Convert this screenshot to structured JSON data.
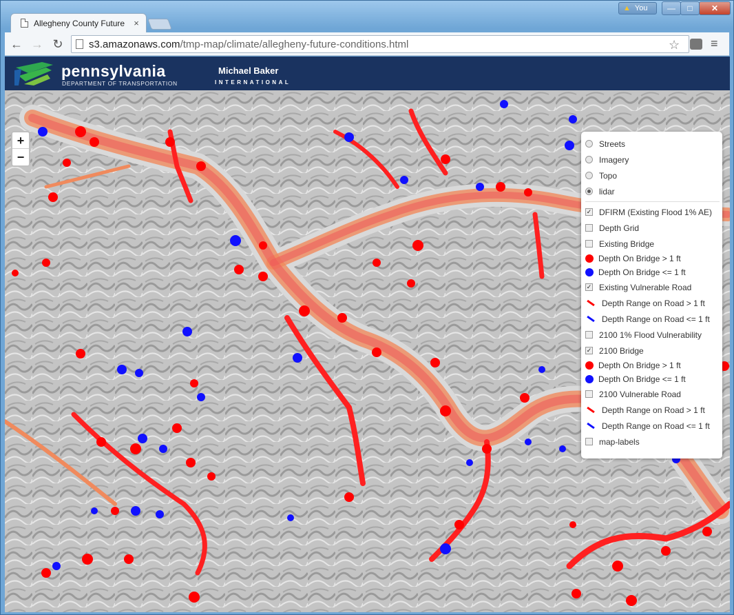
{
  "browser": {
    "tab_title": "Allegheny County Future",
    "tab_close": "×",
    "user_label": "You",
    "url_host": "s3.amazonaws.com",
    "url_path": "/tmp-map/climate/allegheny-future-conditions.html",
    "minimize": "—",
    "maximize": "□",
    "close": "✕"
  },
  "header": {
    "penn_title": "pennsylvania",
    "penn_subtitle": "DEPARTMENT OF TRANSPORTATION",
    "baker_title": "Michael Baker",
    "baker_subtitle": "INTERNATIONAL"
  },
  "map": {
    "zoom_in": "+",
    "zoom_out": "−"
  },
  "layers": {
    "base": [
      {
        "label": "Streets",
        "selected": false
      },
      {
        "label": "Imagery",
        "selected": false
      },
      {
        "label": "Topo",
        "selected": false
      },
      {
        "label": "lidar",
        "selected": true
      }
    ],
    "overlays": {
      "dfirm": "DFIRM (Existing Flood 1% AE)",
      "depth_grid": "Depth Grid",
      "existing_bridge": "Existing Bridge",
      "eb_gt": "Depth On Bridge > 1 ft",
      "eb_le": "Depth On Bridge <= 1 ft",
      "existing_road": "Existing Vulnerable Road",
      "er_gt": "Depth Range on Road > 1 ft",
      "er_le": "Depth Range on Road <= 1 ft",
      "flood2100": "2100 1% Flood Vulnerability",
      "bridge2100": "2100 Bridge",
      "b21_gt": "Depth On Bridge > 1 ft",
      "b21_le": "Depth On Bridge <= 1 ft",
      "road2100": "2100 Vulnerable Road",
      "r21_gt": "Depth Range on Road > 1 ft",
      "r21_le": "Depth Range on Road <= 1 ft",
      "map_labels": "map-labels"
    },
    "checked": {
      "dfirm": true,
      "depth_grid": false,
      "existing_bridge": false,
      "existing_road": true,
      "flood2100": false,
      "bridge2100": true,
      "road2100": false,
      "map_labels": false
    }
  },
  "colors": {
    "depth_gt": "#ff0000",
    "depth_le": "#1010ff",
    "flood_zone": "#f08a5d"
  }
}
